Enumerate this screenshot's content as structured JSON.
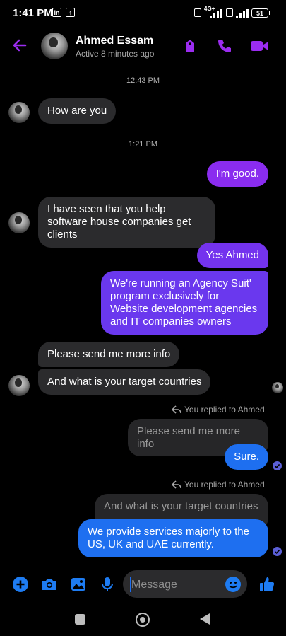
{
  "status_bar": {
    "time": "1:41 PM",
    "network": "4G+",
    "battery": "51"
  },
  "header": {
    "contact_name": "Ahmed Essam",
    "status": "Active 8 minutes ago",
    "icons": [
      "back-arrow-icon",
      "tag-icon",
      "phone-icon",
      "video-icon"
    ],
    "accent_color": "#9b2cf0"
  },
  "conversation": {
    "timestamps": [
      "12:43 PM",
      "1:21 PM"
    ],
    "messages": [
      {
        "from": "them",
        "text": "How are you"
      },
      {
        "from": "me",
        "text": "I'm good."
      },
      {
        "from": "them",
        "text": "I have seen that you help software house companies get clients"
      },
      {
        "from": "me",
        "text": "Yes Ahmed"
      },
      {
        "from": "me",
        "text": "We're running an Agency Suit' program exclusively for Website development agencies and IT companies owners"
      },
      {
        "from": "them",
        "text": "Please send me more info"
      },
      {
        "from": "them",
        "text": "And what is your target countries"
      },
      {
        "from": "me",
        "reply_label": "You replied to Ahmed",
        "quoted": "Please send me more info",
        "text": "Sure."
      },
      {
        "from": "me",
        "reply_label": "You replied to Ahmed",
        "quoted": "And what is your target countries",
        "text": "We provide services majorly to the US, UK and UAE currently."
      }
    ]
  },
  "composer": {
    "placeholder": "Message",
    "icons": [
      "plus-icon",
      "camera-icon",
      "gallery-icon",
      "microphone-icon",
      "emoji-icon",
      "thumbs-up-icon"
    ],
    "icon_color": "#1e7cf2"
  },
  "colors": {
    "incoming_bubble": "#2b2b2d",
    "outgoing_purple": "#8a2cef",
    "outgoing_violet": "#6a38ee",
    "outgoing_blue": "#1e6ff0",
    "background": "#000000"
  }
}
